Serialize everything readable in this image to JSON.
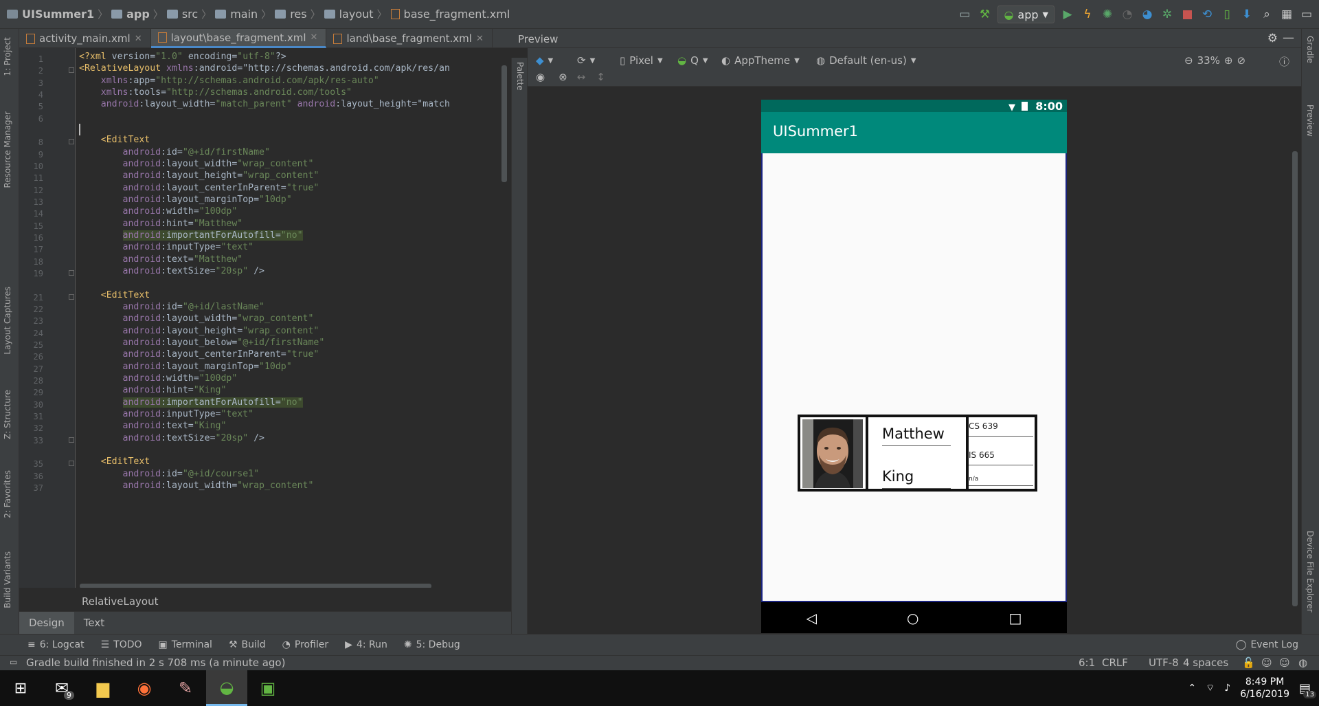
{
  "breadcrumb": {
    "project": "UISummer1",
    "items": [
      "app",
      "src",
      "main",
      "res",
      "layout"
    ],
    "file": "base_fragment.xml"
  },
  "run_config": "app",
  "editor_tabs": [
    {
      "label": "activity_main.xml",
      "active": false
    },
    {
      "label": "layout\\base_fragment.xml",
      "active": true
    },
    {
      "label": "land\\base_fragment.xml",
      "active": false
    }
  ],
  "left_tools": [
    "1: Project",
    "Resource Manager",
    "Layout Captures",
    "Z: Structure",
    "2: Favorites",
    "Build Variants"
  ],
  "right_tools": [
    "Gradle",
    "Preview",
    "Device File Explorer"
  ],
  "line_numbers": [
    "1",
    "2",
    "3",
    "4",
    "5",
    "6",
    "8",
    "9",
    "10",
    "11",
    "12",
    "13",
    "14",
    "15",
    "16",
    "17",
    "18",
    "19",
    "21",
    "22",
    "23",
    "24",
    "25",
    "26",
    "27",
    "28",
    "29",
    "30",
    "31",
    "32",
    "33",
    "35",
    "36",
    "37"
  ],
  "code_lines": [
    "<?xml version=\"1.0\" encoding=\"utf-8\"?>",
    "<RelativeLayout xmlns:android=\"http://schemas.android.com/apk/res/an",
    "    xmlns:app=\"http://schemas.android.com/apk/res-auto\"",
    "    xmlns:tools=\"http://schemas.android.com/tools\"",
    "    android:layout_width=\"match_parent\" android:layout_height=\"match",
    "",
    "    <EditText",
    "        android:id=\"@+id/firstName\"",
    "        android:layout_width=\"wrap_content\"",
    "        android:layout_height=\"wrap_content\"",
    "        android:layout_centerInParent=\"true\"",
    "        android:layout_marginTop=\"10dp\"",
    "        android:width=\"100dp\"",
    "        android:hint=\"Matthew\"",
    "        android:importantForAutofill=\"no\"",
    "        android:inputType=\"text\"",
    "        android:text=\"Matthew\"",
    "        android:textSize=\"20sp\" />",
    "    <EditText",
    "        android:id=\"@+id/lastName\"",
    "        android:layout_width=\"wrap_content\"",
    "        android:layout_height=\"wrap_content\"",
    "        android:layout_below=\"@+id/firstName\"",
    "        android:layout_centerInParent=\"true\"",
    "        android:layout_marginTop=\"10dp\"",
    "        android:width=\"100dp\"",
    "        android:hint=\"King\"",
    "        android:importantForAutofill=\"no\"",
    "        android:inputType=\"text\"",
    "        android:text=\"King\"",
    "        android:textSize=\"20sp\" />",
    "    <EditText",
    "        android:id=\"@+id/course1\"",
    "        android:layout_width=\"wrap_content\""
  ],
  "component_crumb": "RelativeLayout",
  "design_tabs": [
    "Design",
    "Text"
  ],
  "preview": {
    "title": "Preview",
    "device": "Pixel",
    "api": "Q",
    "theme": "AppTheme",
    "locale": "Default (en-us)",
    "zoom": "33%",
    "palette": "Palette"
  },
  "phone": {
    "time": "8:00",
    "app_title": "UISummer1",
    "first_name": "Matthew",
    "last_name": "King",
    "courses": [
      "CS 639",
      "IS 665",
      "n/a"
    ]
  },
  "bottom_tools": [
    "6: Logcat",
    "TODO",
    "Terminal",
    "Build",
    "Profiler",
    "4: Run",
    "5: Debug"
  ],
  "event_log": "Event Log",
  "status": {
    "message": "Gradle build finished in 2 s 708 ms (a minute ago)",
    "position": "6:1",
    "line_sep": "CRLF",
    "encoding": "UTF-8",
    "indent": "4 spaces"
  },
  "taskbar": {
    "time": "8:49 PM",
    "date": "6/16/2019",
    "mail_badge": "9",
    "notif_count": "13"
  }
}
